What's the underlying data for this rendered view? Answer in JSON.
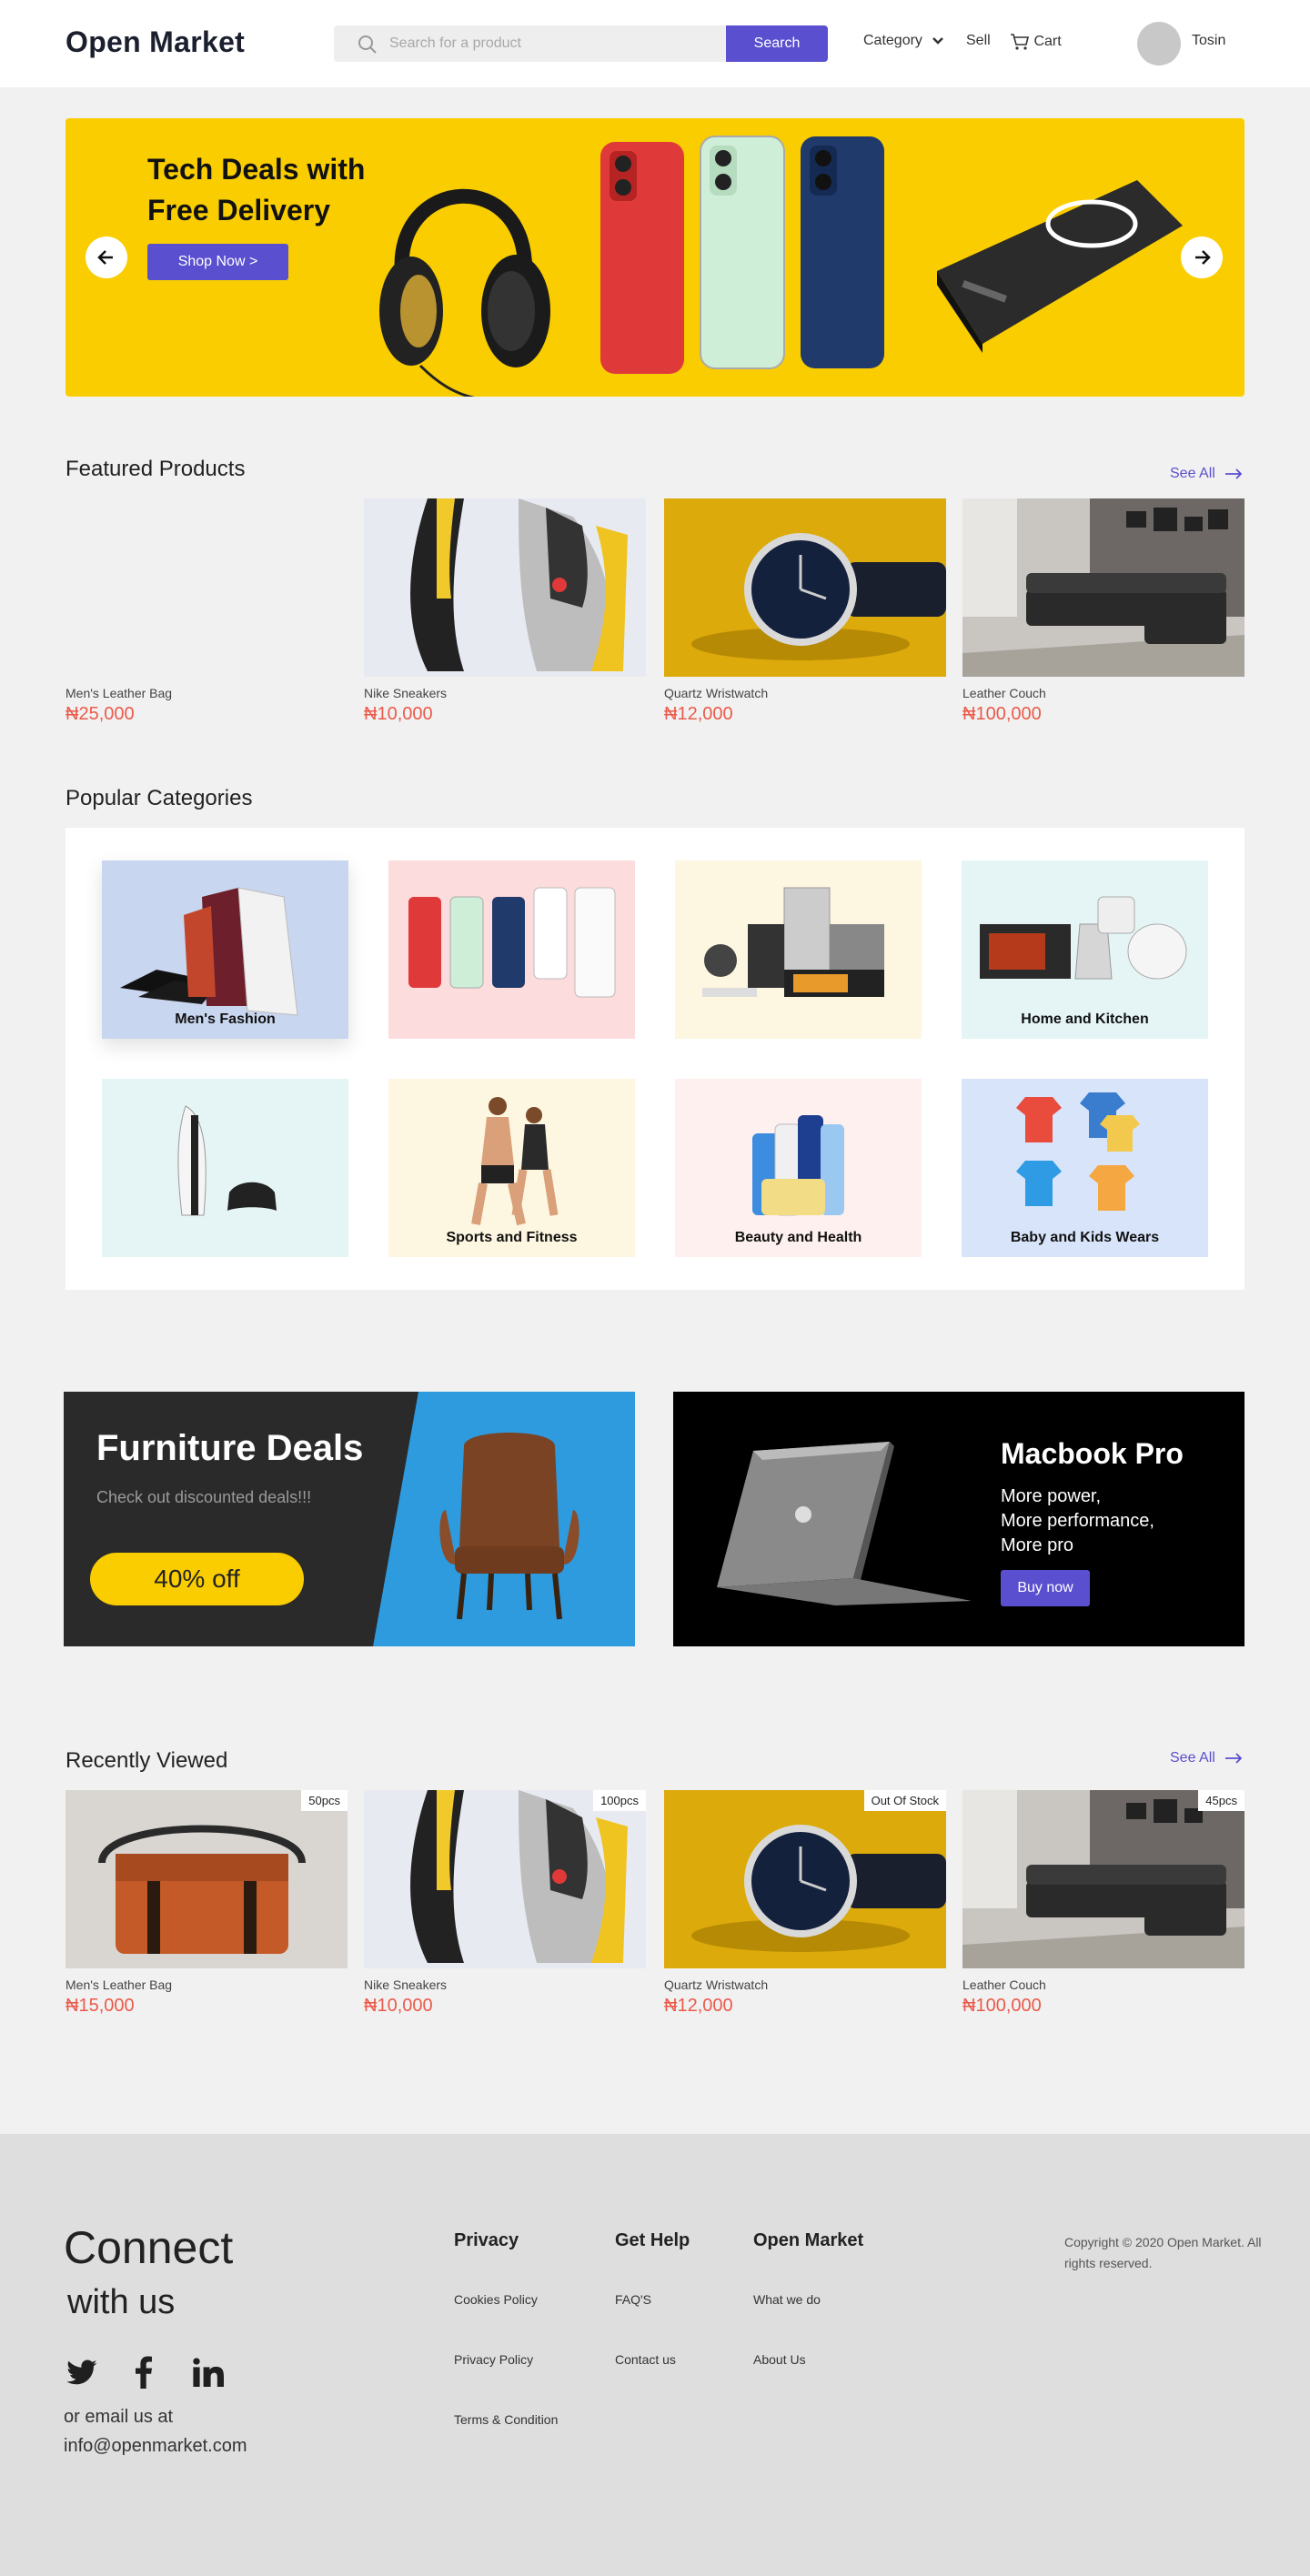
{
  "header": {
    "logo": "Open Market",
    "search_placeholder": "Search for a product",
    "search_button": "Search",
    "category": "Category",
    "sell": "Sell",
    "cart": "Cart",
    "user": "Tosin",
    "accent_color": "#5a4fcf"
  },
  "hero": {
    "title_line1": "Tech Deals with",
    "title_line2": "Free Delivery",
    "button": "Shop Now >",
    "bg_color": "#facd00"
  },
  "featured": {
    "title": "Featured Products",
    "see_all": "See All",
    "items": [
      {
        "name": "Men's Leather Bag",
        "price": "₦25,000"
      },
      {
        "name": "Nike Sneakers",
        "price": "₦10,000"
      },
      {
        "name": "Quartz Wristwatch",
        "price": "₦12,000"
      },
      {
        "name": "Leather Couch",
        "price": "₦100,000"
      }
    ]
  },
  "categories": {
    "title": "Popular Categories",
    "items": [
      {
        "label": "Men's Fashion",
        "icon": "clothes-icon"
      },
      {
        "label": "",
        "icon": "phones-icon"
      },
      {
        "label": "",
        "icon": "appliances-icon"
      },
      {
        "label": "Home and Kitchen",
        "icon": "kitchen-icon"
      },
      {
        "label": "",
        "icon": "console-icon"
      },
      {
        "label": "Sports and Fitness",
        "icon": "fitness-icon"
      },
      {
        "label": "Beauty and Health",
        "icon": "beauty-icon"
      },
      {
        "label": "Baby and Kids Wears",
        "icon": "kids-icon"
      }
    ]
  },
  "promo_furniture": {
    "title": "Furniture Deals",
    "subtitle": "Check out discounted deals!!!",
    "badge": "40% off"
  },
  "promo_macbook": {
    "title": "Macbook Pro",
    "line1": "More power,",
    "line2": "More performance,",
    "line3": "More pro",
    "button": "Buy now"
  },
  "recent": {
    "title": "Recently Viewed",
    "see_all": "See All",
    "items": [
      {
        "name": "Men's Leather Bag",
        "price": "₦15,000",
        "badge": "50pcs"
      },
      {
        "name": "Nike Sneakers",
        "price": "₦10,000",
        "badge": "100pcs"
      },
      {
        "name": "Quartz Wristwatch",
        "price": "₦12,000",
        "badge": "Out Of Stock"
      },
      {
        "name": "Leather Couch",
        "price": "₦100,000",
        "badge": "45pcs"
      }
    ]
  },
  "footer": {
    "connect1": "Connect",
    "connect2": "with us",
    "email_label": "or email us at",
    "email": "info@openmarket.com",
    "col1": {
      "title": "Privacy",
      "links": [
        "Cookies Policy",
        "Privacy Policy",
        "Terms & Condition"
      ]
    },
    "col2": {
      "title": "Get Help",
      "links": [
        "FAQ'S",
        "Contact us"
      ]
    },
    "col3": {
      "title": "Open Market",
      "links": [
        "What we do",
        "About Us"
      ]
    },
    "copyright": "Copyright © 2020 Open Market. All rights reserved."
  }
}
